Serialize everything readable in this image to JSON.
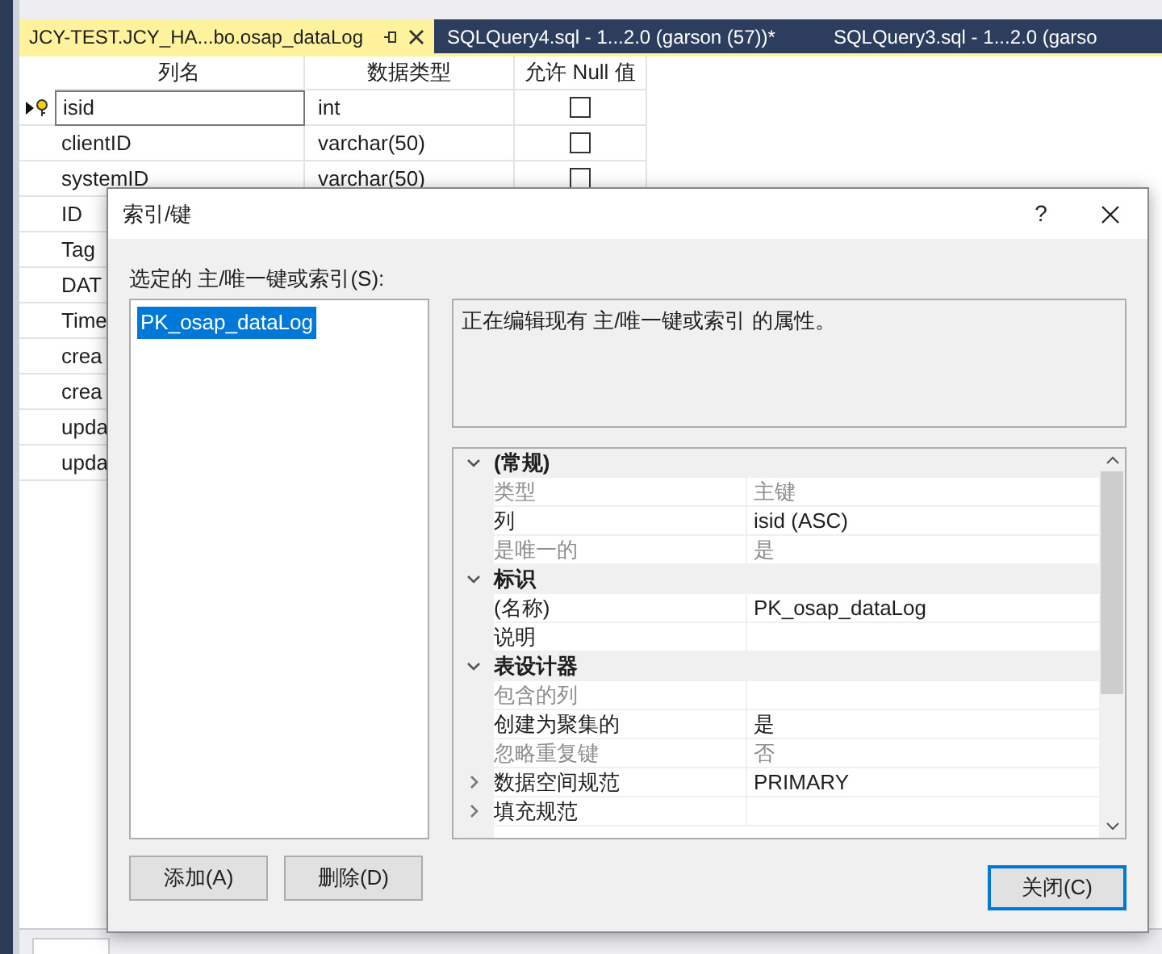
{
  "tabs": [
    {
      "label": "JCY-TEST.JCY_HA...bo.osap_dataLog",
      "selected": true
    },
    {
      "label": "SQLQuery4.sql - 1...2.0 (garson (57))*",
      "selected": false
    },
    {
      "label": "SQLQuery3.sql - 1...2.0 (garso",
      "selected": false
    }
  ],
  "table": {
    "columns": [
      "列名",
      "数据类型",
      "允许 Null 值"
    ],
    "rows": [
      {
        "name": "isid",
        "type": "int",
        "allow_null": false,
        "current": true,
        "primary_key": true
      },
      {
        "name": "clientID",
        "type": "varchar(50)",
        "allow_null": false,
        "current": false,
        "primary_key": false
      },
      {
        "name": "systemID",
        "type": "varchar(50)",
        "allow_null": false,
        "current": false,
        "primary_key": false
      },
      {
        "name": "ID",
        "current": false,
        "primary_key": false
      },
      {
        "name": "Tag",
        "current": false,
        "primary_key": false
      },
      {
        "name": "DAT",
        "current": false,
        "primary_key": false
      },
      {
        "name": "Time",
        "current": false,
        "primary_key": false
      },
      {
        "name": "crea",
        "current": false,
        "primary_key": false
      },
      {
        "name": "crea",
        "current": false,
        "primary_key": false
      },
      {
        "name": "upda",
        "current": false,
        "primary_key": false
      },
      {
        "name": "upda",
        "current": false,
        "primary_key": false
      }
    ]
  },
  "dialog": {
    "title": "索引/键",
    "help": "?",
    "list_label": "选定的 主/唯一键或索引(S):",
    "keys": [
      {
        "label": "PK_osap_dataLog",
        "selected": true
      }
    ],
    "description": "正在编辑现有 主/唯一键或索引 的属性。",
    "properties": [
      {
        "kind": "category",
        "label": "(常规)",
        "expanded": true
      },
      {
        "kind": "property",
        "label": "类型",
        "value": "主键",
        "disabled": true
      },
      {
        "kind": "property",
        "label": "列",
        "value": "isid (ASC)",
        "disabled": false
      },
      {
        "kind": "property",
        "label": "是唯一的",
        "value": "是",
        "disabled": true
      },
      {
        "kind": "category",
        "label": "标识",
        "expanded": true
      },
      {
        "kind": "property",
        "label": "(名称)",
        "value": "PK_osap_dataLog",
        "disabled": false
      },
      {
        "kind": "property",
        "label": "说明",
        "disabled": false
      },
      {
        "kind": "category",
        "label": "表设计器",
        "expanded": true
      },
      {
        "kind": "property",
        "label": "包含的列",
        "disabled": true
      },
      {
        "kind": "property",
        "label": "创建为聚集的",
        "value": "是",
        "disabled": false
      },
      {
        "kind": "property",
        "label": "忽略重复键",
        "value": "否",
        "disabled": true
      },
      {
        "kind": "group",
        "label": "数据空间规范",
        "value": "PRIMARY",
        "disabled": false,
        "expanded": false
      },
      {
        "kind": "group",
        "label": "填充规范",
        "disabled": false,
        "expanded": false
      }
    ],
    "buttons": [
      {
        "label": "添加(A)",
        "default": false
      },
      {
        "label": "删除(D)",
        "default": false
      },
      {
        "label": "关闭(C)",
        "default": true
      }
    ]
  }
}
